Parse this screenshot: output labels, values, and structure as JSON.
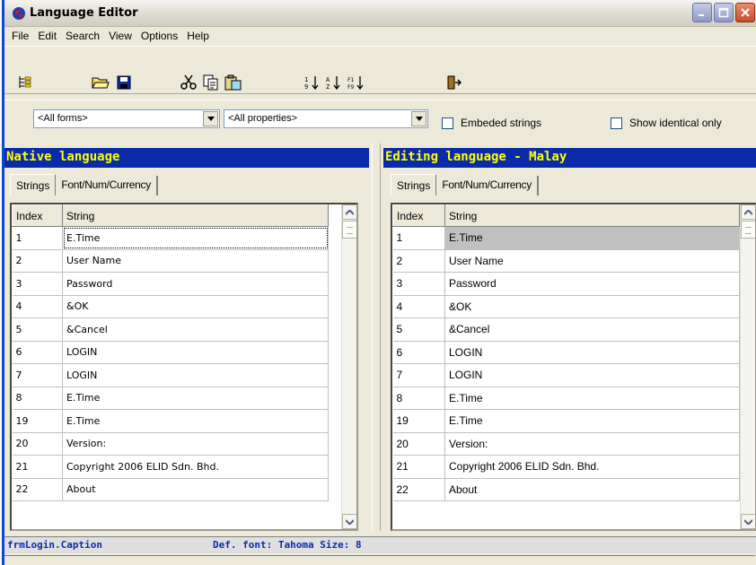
{
  "window": {
    "title": "Language Editor"
  },
  "menu": [
    "File",
    "Edit",
    "Search",
    "View",
    "Options",
    "Help"
  ],
  "toolbar": {
    "icons": [
      "tree-icon",
      "open-folder-icon",
      "save-icon",
      "cut-icon",
      "copy-icon",
      "paste-icon",
      "sort-index-icon",
      "sort-az-icon",
      "sort-f1-icon",
      "exit-icon"
    ]
  },
  "filters": {
    "forms_value": "<All forms>",
    "properties_value": "<All properties>",
    "embeded_strings_label": "Embeded strings",
    "show_identical_label": "Show identical only"
  },
  "left_pane": {
    "header": "Native language",
    "tabs": [
      "Strings",
      "Font/Num/Currency"
    ],
    "columns": [
      "Index",
      "String"
    ],
    "rows": [
      [
        "1",
        "E.Time"
      ],
      [
        "2",
        "User Name"
      ],
      [
        "3",
        "Password"
      ],
      [
        "4",
        "&OK"
      ],
      [
        "5",
        "&Cancel"
      ],
      [
        "6",
        "LOGIN"
      ],
      [
        "7",
        "LOGIN"
      ],
      [
        "8",
        "E.Time"
      ],
      [
        "19",
        "E.Time"
      ],
      [
        "20",
        "Version:"
      ],
      [
        "21",
        "Copyright 2006 ELID Sdn. Bhd."
      ],
      [
        "22",
        "About"
      ]
    ]
  },
  "right_pane": {
    "header": "Editing language - Malay",
    "tabs": [
      "Strings",
      "Font/Num/Currency"
    ],
    "columns": [
      "Index",
      "String"
    ],
    "rows": [
      [
        "1",
        "E.Time"
      ],
      [
        "2",
        "User Name"
      ],
      [
        "3",
        "Password"
      ],
      [
        "4",
        "&OK"
      ],
      [
        "5",
        "&Cancel"
      ],
      [
        "6",
        "LOGIN"
      ],
      [
        "7",
        "LOGIN"
      ],
      [
        "8",
        "E.Time"
      ],
      [
        "19",
        "E.Time"
      ],
      [
        "20",
        "Version:"
      ],
      [
        "21",
        "Copyright 2006 ELID Sdn. Bhd."
      ],
      [
        "22",
        "About"
      ]
    ]
  },
  "status": {
    "property": "frmLogin.Caption",
    "font_info": "Def. font: Tahoma Size: 8"
  },
  "colors": {
    "header_bg": "#0a2ba8",
    "header_text": "#ffff00",
    "status_text": "#0a2ba8"
  }
}
